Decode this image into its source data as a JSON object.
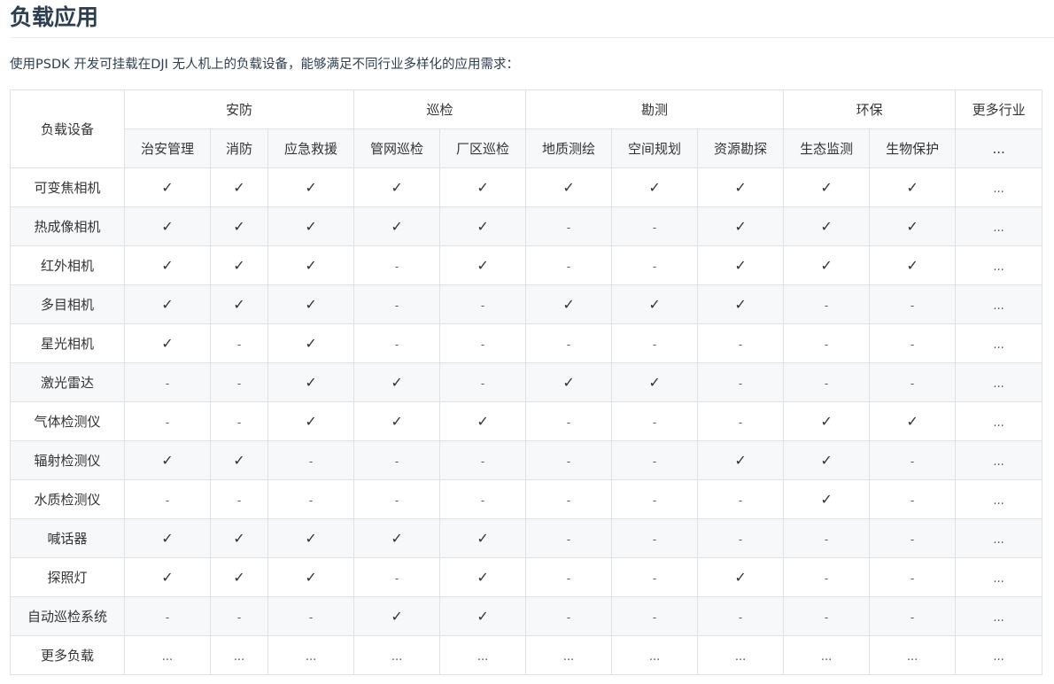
{
  "title": "负载应用",
  "intro": "使用PSDK 开发可挂载在DJI 无人机上的负载设备，能够满足不同行业多样化的应用需求：",
  "table": {
    "corner": "负载设备",
    "groups": [
      {
        "label": "安防",
        "span": 3
      },
      {
        "label": "巡检",
        "span": 2
      },
      {
        "label": "勘测",
        "span": 3
      },
      {
        "label": "环保",
        "span": 2
      },
      {
        "label": "更多行业",
        "span": 1
      }
    ],
    "subheaders": [
      "治安管理",
      "消防",
      "应急救援",
      "管网巡检",
      "厂区巡检",
      "地质测绘",
      "空间规划",
      "资源勘探",
      "生态监测",
      "生物保护",
      "..."
    ],
    "rows": [
      {
        "name": "可变焦相机",
        "cells": [
          "✓",
          "✓",
          "✓",
          "✓",
          "✓",
          "✓",
          "✓",
          "✓",
          "✓",
          "✓",
          "..."
        ]
      },
      {
        "name": "热成像相机",
        "cells": [
          "✓",
          "✓",
          "✓",
          "✓",
          "✓",
          "-",
          "-",
          "✓",
          "✓",
          "✓",
          "..."
        ]
      },
      {
        "name": "红外相机",
        "cells": [
          "✓",
          "✓",
          "✓",
          "-",
          "✓",
          "-",
          "-",
          "✓",
          "✓",
          "✓",
          "..."
        ]
      },
      {
        "name": "多目相机",
        "cells": [
          "✓",
          "✓",
          "✓",
          "-",
          "-",
          "✓",
          "✓",
          "✓",
          "-",
          "-",
          "..."
        ]
      },
      {
        "name": "星光相机",
        "cells": [
          "✓",
          "-",
          "✓",
          "-",
          "-",
          "-",
          "-",
          "-",
          "-",
          "-",
          "..."
        ]
      },
      {
        "name": "激光雷达",
        "cells": [
          "-",
          "-",
          "✓",
          "✓",
          "-",
          "✓",
          "✓",
          "-",
          "-",
          "-",
          "..."
        ]
      },
      {
        "name": "气体检测仪",
        "cells": [
          "-",
          "-",
          "✓",
          "✓",
          "✓",
          "-",
          "-",
          "-",
          "✓",
          "✓",
          "..."
        ]
      },
      {
        "name": "辐射检测仪",
        "cells": [
          "✓",
          "✓",
          "-",
          "-",
          "-",
          "-",
          "-",
          "✓",
          "✓",
          "-",
          "..."
        ]
      },
      {
        "name": "水质检测仪",
        "cells": [
          "-",
          "-",
          "-",
          "-",
          "-",
          "-",
          "-",
          "-",
          "✓",
          "-",
          "..."
        ]
      },
      {
        "name": "喊话器",
        "cells": [
          "✓",
          "✓",
          "✓",
          "✓",
          "✓",
          "-",
          "-",
          "-",
          "-",
          "-",
          "..."
        ]
      },
      {
        "name": "探照灯",
        "cells": [
          "✓",
          "✓",
          "✓",
          "-",
          "✓",
          "-",
          "-",
          "✓",
          "-",
          "-",
          "..."
        ]
      },
      {
        "name": "自动巡检系统",
        "cells": [
          "-",
          "-",
          "-",
          "✓",
          "✓",
          "-",
          "-",
          "-",
          "-",
          "-",
          "..."
        ]
      },
      {
        "name": "更多负载",
        "cells": [
          "...",
          "...",
          "...",
          "...",
          "...",
          "...",
          "...",
          "...",
          "...",
          "...",
          "..."
        ]
      }
    ]
  }
}
